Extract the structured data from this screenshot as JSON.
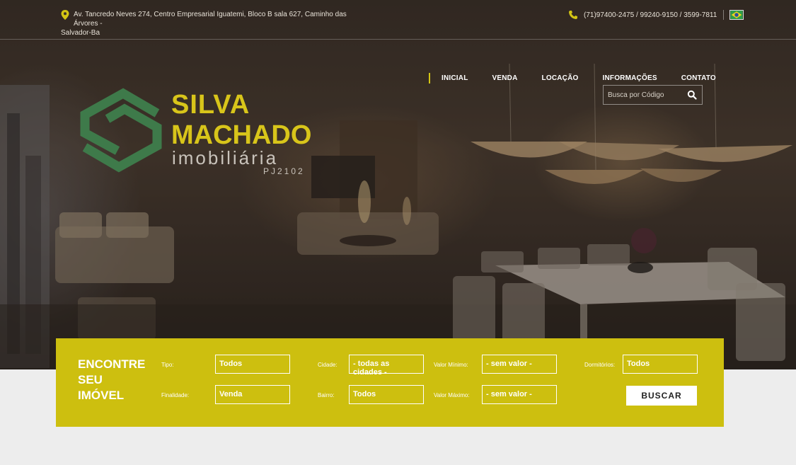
{
  "topbar": {
    "address_line1": "Av. Tancredo Neves 274, Centro Empresarial Iguatemi, Bloco B sala 627, Caminho das Árvores -",
    "address_line2": "Salvador-Ba",
    "phones": "(71)97400-2475 / 99240-9150 / 3599-7811",
    "language_flag": "brazil-flag-icon"
  },
  "nav": {
    "items": [
      {
        "label": "INICIAL"
      },
      {
        "label": "VENDA"
      },
      {
        "label": "LOCAÇÃO"
      },
      {
        "label": "INFORMAÇÕES"
      },
      {
        "label": "CONTATO"
      }
    ],
    "search_placeholder": "Busca por Código"
  },
  "logo": {
    "line1": "SILVA",
    "line2": "MACHADO",
    "line3": "imobiliária",
    "registration": "PJ2102"
  },
  "search_panel": {
    "title_line1": "ENCONTRE",
    "title_line2": "SEU",
    "title_line3": "IMÓVEL",
    "tipo": {
      "label": "Tipo:",
      "value": "Todos"
    },
    "finalidade": {
      "label": "Finalidade:",
      "value": "Venda"
    },
    "cidade": {
      "label": "Cidade:",
      "value": "- todas as cidades -"
    },
    "bairro": {
      "label": "Bairro:",
      "value": "Todos"
    },
    "valor_minimo": {
      "label": "Valor Mínimo:",
      "value": "- sem valor -"
    },
    "valor_maximo": {
      "label": "Valor Máximo:",
      "value": "- sem valor -"
    },
    "dormitorios": {
      "label": "Dormitórios:",
      "value": "Todos"
    },
    "button_label": "BUSCAR"
  },
  "colors": {
    "accent": "#cdbf0f",
    "logo_text": "#d8c51a",
    "logo_mark": "#3e7a4a",
    "page_bg": "#ededed"
  }
}
